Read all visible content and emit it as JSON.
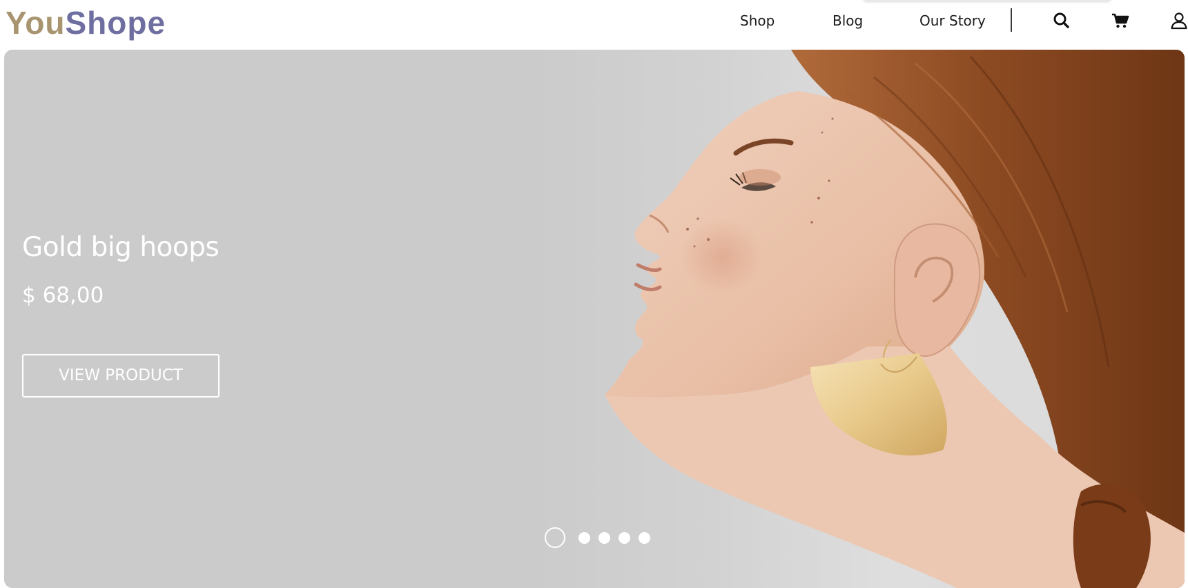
{
  "header": {
    "logo_part1": "You",
    "logo_part2": "Shope",
    "nav": {
      "shop": "Shop",
      "blog": "Blog",
      "our_story": "Our Story"
    },
    "icons": [
      "search-icon",
      "cart-icon",
      "user-icon"
    ]
  },
  "hero": {
    "title": "Gold big hoops",
    "price": "$ 68,00",
    "button_label": "VIEW PRODUCT",
    "slides_total": 5,
    "active_slide": 1
  },
  "colors": {
    "logo_you": "#a89570",
    "logo_shope": "#6f6ea0",
    "hero_background": "#cbcbcb",
    "text_on_hero": "#ffffff",
    "earring_gold": "#e8c98a",
    "hair": "#8c4a22"
  }
}
